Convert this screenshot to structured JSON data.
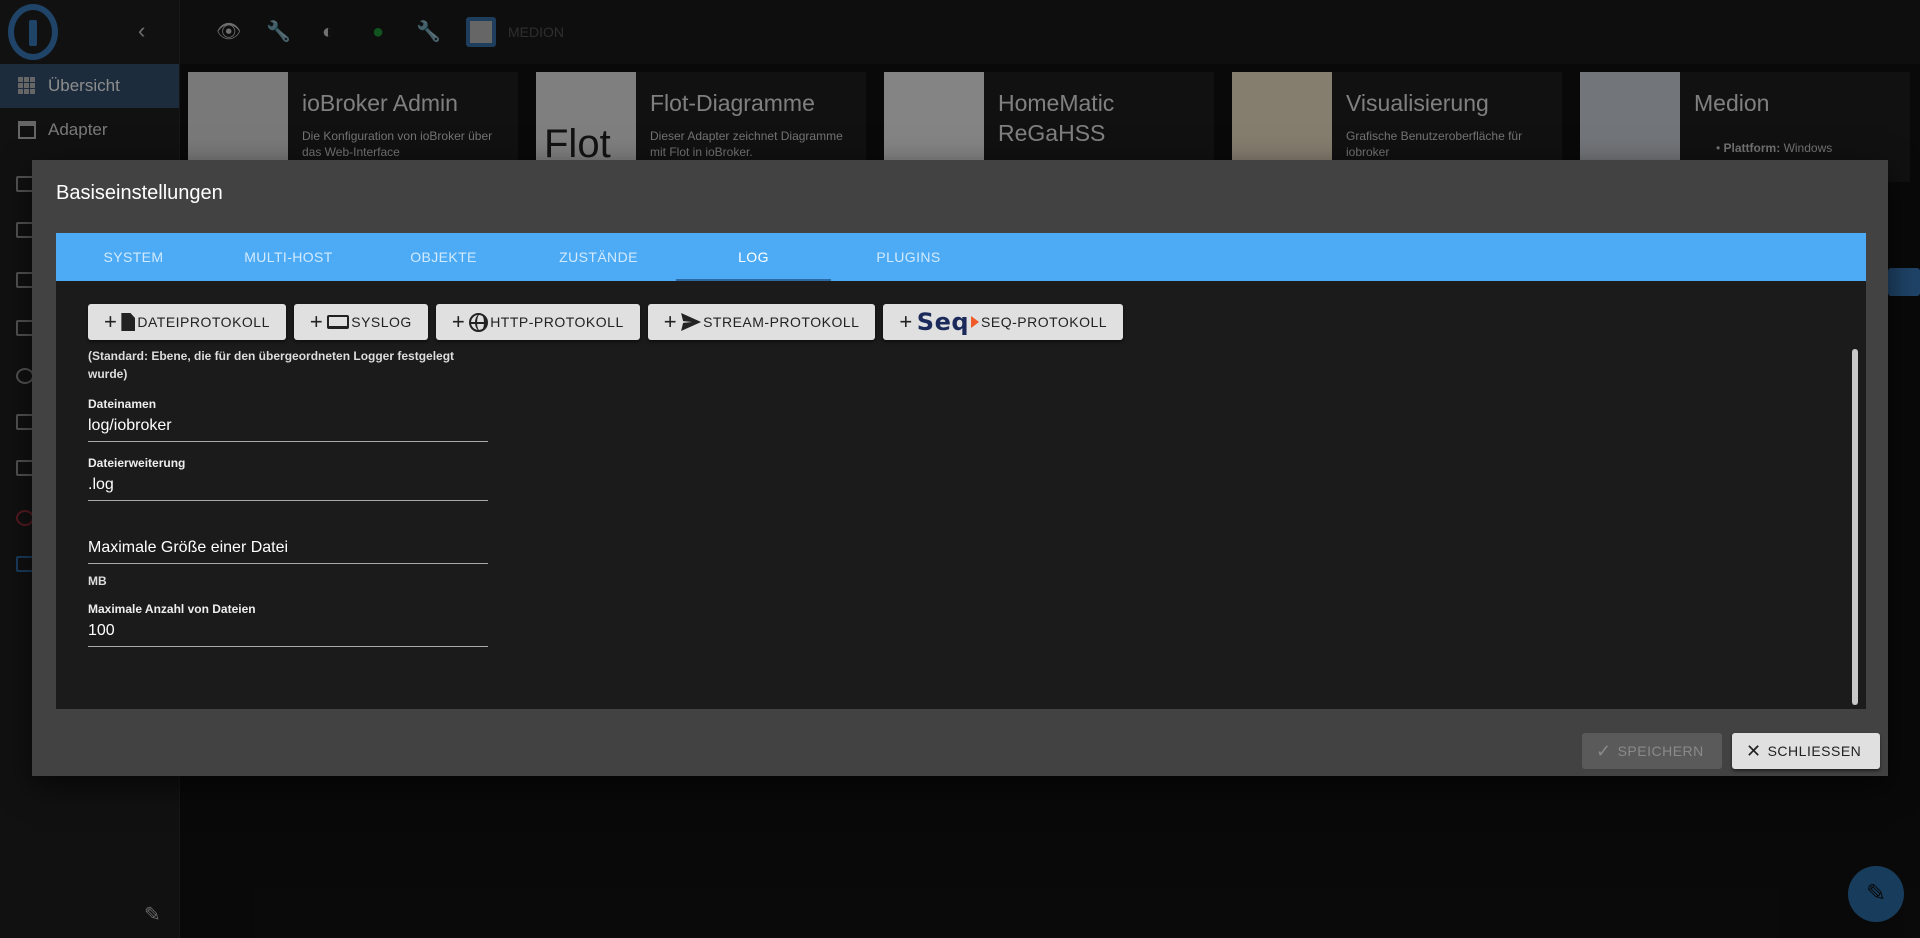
{
  "sidebar": {
    "items": [
      {
        "label": "Übersicht"
      },
      {
        "label": "Adapter"
      }
    ]
  },
  "topbar": {
    "host_name": "MEDION"
  },
  "cards": [
    {
      "title": "ioBroker Admin",
      "desc": "Die Konfiguration von ioBroker über das Web-Interface"
    },
    {
      "title": "Flot-Diagramme",
      "desc": "Dieser Adapter zeichnet Diagramme mit Flot in ioBroker.",
      "img_text": "Flot"
    },
    {
      "title": "HomeMatic ReGaHSS",
      "desc": ""
    },
    {
      "title": "Visualisierung",
      "desc": "Grafische Benutzeroberfläche für iobroker"
    },
    {
      "title": "Medion",
      "desc_label": "Plattform:",
      "desc": "Windows"
    }
  ],
  "dialog": {
    "title": "Basiseinstellungen",
    "tabs": [
      "SYSTEM",
      "MULTI-HOST",
      "OBJEKTE",
      "ZUSTÄNDE",
      "LOG",
      "PLUGINS"
    ],
    "active_tab": "LOG",
    "buttons": [
      {
        "label": "DATEIPROTOKOLL",
        "icon": "file-icon"
      },
      {
        "label": "SYSLOG",
        "icon": "laptop-icon"
      },
      {
        "label": "HTTP-PROTOKOLL",
        "icon": "globe-icon"
      },
      {
        "label": "STREAM-PROTOKOLL",
        "icon": "send-icon"
      },
      {
        "label": "SEQ-PROTOKOLL",
        "icon": "seq-icon",
        "brand": "Seq"
      }
    ],
    "hint": "(Standard: Ebene, die für den übergeordneten Logger festgelegt wurde)",
    "fields": {
      "filename": {
        "label": "Dateinamen",
        "value": "log/iobroker"
      },
      "extension": {
        "label": "Dateierweiterung",
        "value": ".log"
      },
      "maxsize": {
        "placeholder": "Maximale Größe einer Datei",
        "unit": "MB"
      },
      "maxfiles": {
        "label": "Maximale Anzahl von Dateien",
        "value": "100"
      }
    },
    "save_label": "SPEICHERN",
    "close_label": "SCHLIESSEN"
  },
  "colors": {
    "tab_bar": "#4dabf5",
    "accent": "#3a7cbd",
    "dialog_bg": "#424242"
  }
}
